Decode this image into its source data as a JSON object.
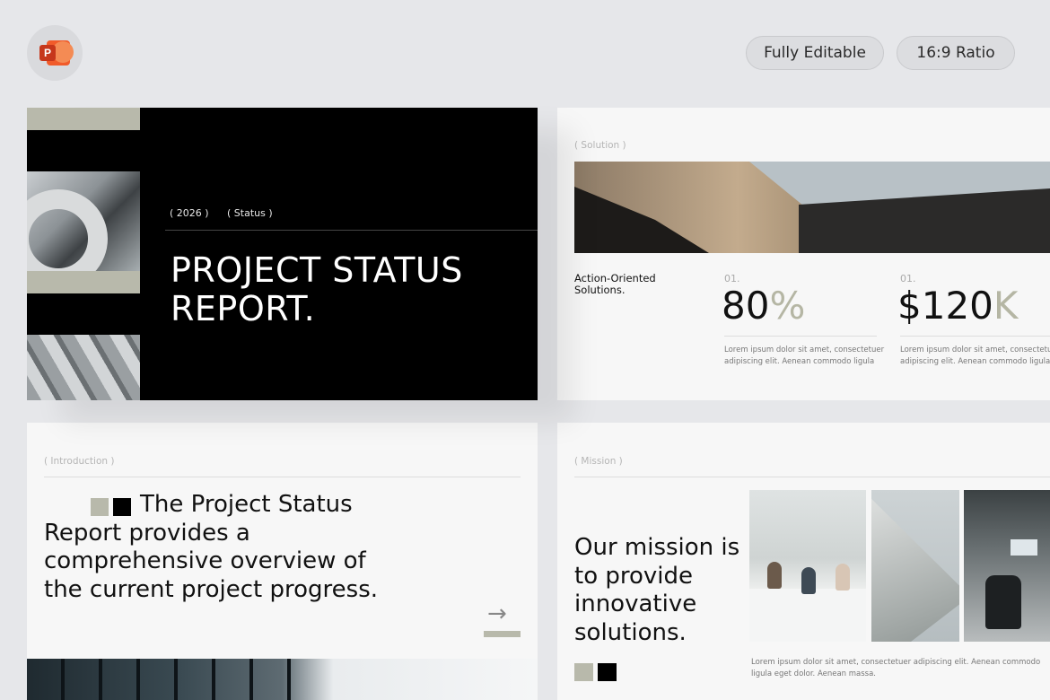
{
  "header": {
    "app_icon": "powerpoint-icon",
    "app_icon_letter": "P",
    "badges": [
      "Fully Editable",
      "16:9 Ratio"
    ]
  },
  "slides": [
    {
      "year": "( 2026 )",
      "tag": "( Status )",
      "title": "PROJECT STATUS REPORT."
    },
    {
      "label": "( Solution )",
      "heading": "Action-Oriented Solutions.",
      "stats": [
        {
          "index": "01.",
          "value": "80",
          "suffix": "%",
          "text_line1": "Lorem ipsum dolor sit amet, consectetuer",
          "text_line2": "adipiscing elit. Aenean commodo ligula"
        },
        {
          "index": "01.",
          "value": "$120",
          "suffix": "K",
          "text_line1": "Lorem ipsum dolor sit amet, consectetuer",
          "text_line2": "adipiscing elit. Aenean commodo ligula"
        }
      ]
    },
    {
      "label": "( Introduction )",
      "text": "The Project Status Report provides a comprehensive overview of the current project progress.",
      "arrow": "→"
    },
    {
      "label": "( Mission )",
      "text": "Our mission is to provide innovative solutions.",
      "caption": "Lorem ipsum dolor sit amet, consectetuer adipiscing elit. Aenean commodo ligula eget dolor. Aenean massa."
    }
  ],
  "colors": {
    "background": "#e6e7ea",
    "accent_sage": "#b8b9ab",
    "slide_dark": "#000000",
    "slide_light": "#f7f7f7"
  }
}
